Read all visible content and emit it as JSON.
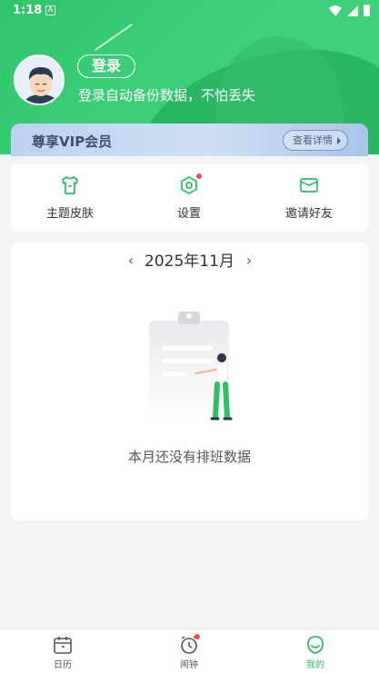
{
  "status_bar": {
    "time": "1:18",
    "notification_glyph": "A"
  },
  "profile": {
    "login_label": "登录",
    "subtitle": "登录自动备份数据，不怕丢失"
  },
  "vip": {
    "title": "尊享VIP会员",
    "details_label": "查看详情"
  },
  "tools": [
    {
      "label": "主题皮肤",
      "icon": "tshirt-icon"
    },
    {
      "label": "设置",
      "icon": "hex-settings-icon",
      "badge": true
    },
    {
      "label": "邀请好友",
      "icon": "envelope-icon"
    }
  ],
  "calendar": {
    "month_label": "2025年11月",
    "prev": "‹",
    "next": "›",
    "empty_text": "本月还没有排班数据"
  },
  "tabbar": [
    {
      "label": "日历",
      "icon": "calendar-icon",
      "active": false
    },
    {
      "label": "闹钟",
      "icon": "alarm-clock-icon",
      "active": false,
      "badge": true
    },
    {
      "label": "我的",
      "icon": "smile-face-icon",
      "active": true
    }
  ],
  "colors": {
    "accent": "#2fbd68",
    "header": "#3ccf78",
    "badge": "#ef4b4b",
    "vip": "#cfe0f5"
  }
}
